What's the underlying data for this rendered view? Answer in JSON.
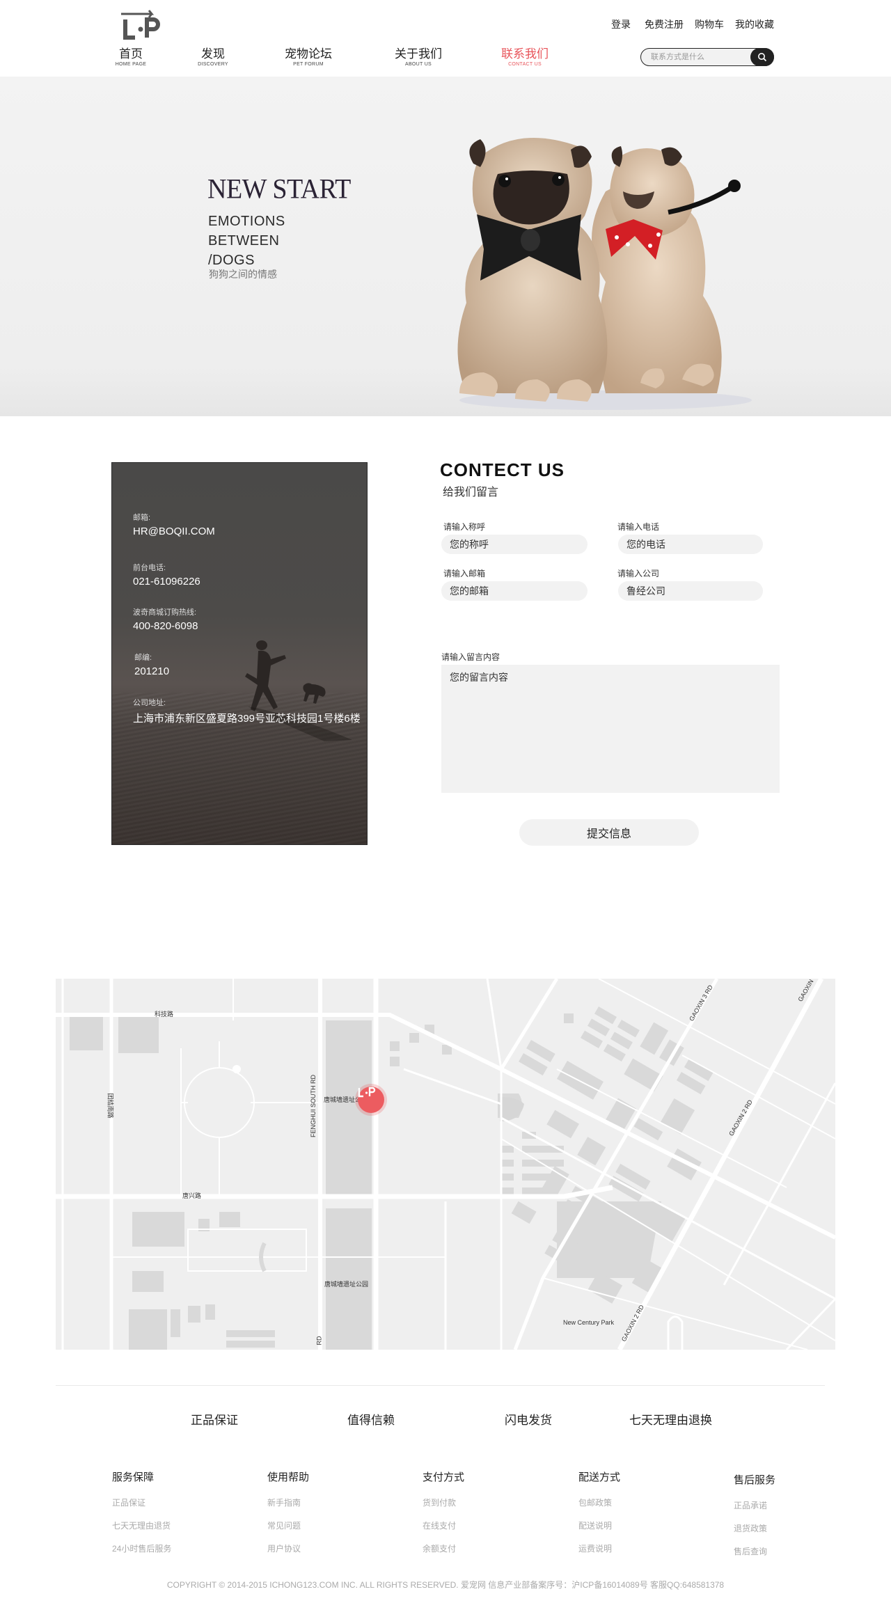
{
  "header": {
    "top_links": [
      "登录",
      "免费注册",
      "购物车",
      "我的收藏"
    ],
    "nav": [
      {
        "cn": "首页",
        "en": "HOME PAGE",
        "active": false
      },
      {
        "cn": "发现",
        "en": "DISCOVERY",
        "active": false
      },
      {
        "cn": "宠物论坛",
        "en": "PET FORUM",
        "active": false
      },
      {
        "cn": "关于我们",
        "en": "ABOUT US",
        "active": false
      },
      {
        "cn": "联系我们",
        "en": "CONTACT US",
        "active": true
      }
    ],
    "search_placeholder": "联系方式是什么"
  },
  "hero": {
    "title": "NEW START",
    "sub_line1": "EMOTIONS",
    "sub_line2": "BETWEEN",
    "sub_line3": "/DOGS",
    "cn": "狗狗之间的情感"
  },
  "info": {
    "email_label": "邮箱:",
    "email": "HR@BOQII.COM",
    "phone_label": "前台电话:",
    "phone": "021-61096226",
    "hotline_label": "波奇商城订购热线:",
    "hotline": "400-820-6098",
    "zip_label": "邮编:",
    "zip": "201210",
    "address_label": "公司地址:",
    "address": "上海市浦东新区盛夏路399号亚芯科技园1号楼6楼"
  },
  "contact": {
    "title": "CONTECT US",
    "subtitle": "给我们留言",
    "name_label": "请输入称呼",
    "name_placeholder": "您的称呼",
    "phone_label": "请输入电话",
    "phone_placeholder": "您的电话",
    "email_label": "请输入邮箱",
    "email_placeholder": "您的邮箱",
    "company_label": "请输入公司",
    "company_placeholder": "鲁经公司",
    "message_label": "请输入留言内容",
    "message_placeholder": "您的留言内容",
    "submit": "提交信息"
  },
  "map": {
    "labels": {
      "keji": "科技路",
      "tanggui": "唐兴路",
      "fenghui": "FENGHUI SOUTH RD",
      "site1": "唐城墙遗址公",
      "site2": "唐城墙遗址公园",
      "left_vertical": "团结南路",
      "gaoxin3": "GAOXIN 3 RD",
      "gaoxin2a": "GAOXIN 2 RD",
      "gaoxin2b": "GAOXIN 2 RD",
      "gaoxin_corner": "GAOXIN",
      "new_century": "New Century Park",
      "rd": "RD"
    }
  },
  "footer": {
    "guarantees": [
      "正品保证",
      "值得信赖",
      "闪电发货",
      "七天无理由退换"
    ],
    "columns": [
      {
        "title": "服务保障",
        "links": [
          "正品保证",
          "七天无理由退货",
          "24小时售后服务"
        ]
      },
      {
        "title": "使用帮助",
        "links": [
          "新手指南",
          "常见问题",
          "用户协议"
        ]
      },
      {
        "title": "支付方式",
        "links": [
          "货到付款",
          "在线支付",
          "余额支付"
        ]
      },
      {
        "title": "配送方式",
        "links": [
          "包邮政策",
          "配送说明",
          "运费说明"
        ]
      },
      {
        "title": "售后服务",
        "links": [
          "正品承诺",
          "退货政策",
          "售后查询"
        ]
      }
    ],
    "copyright": "COPYRIGHT © 2014-2015 ICHONG123.COM INC. ALL RIGHTS RESERVED. 爱宠网 信息产业部备案序号：沪ICP备16014089号 客服QQ:648581378"
  }
}
